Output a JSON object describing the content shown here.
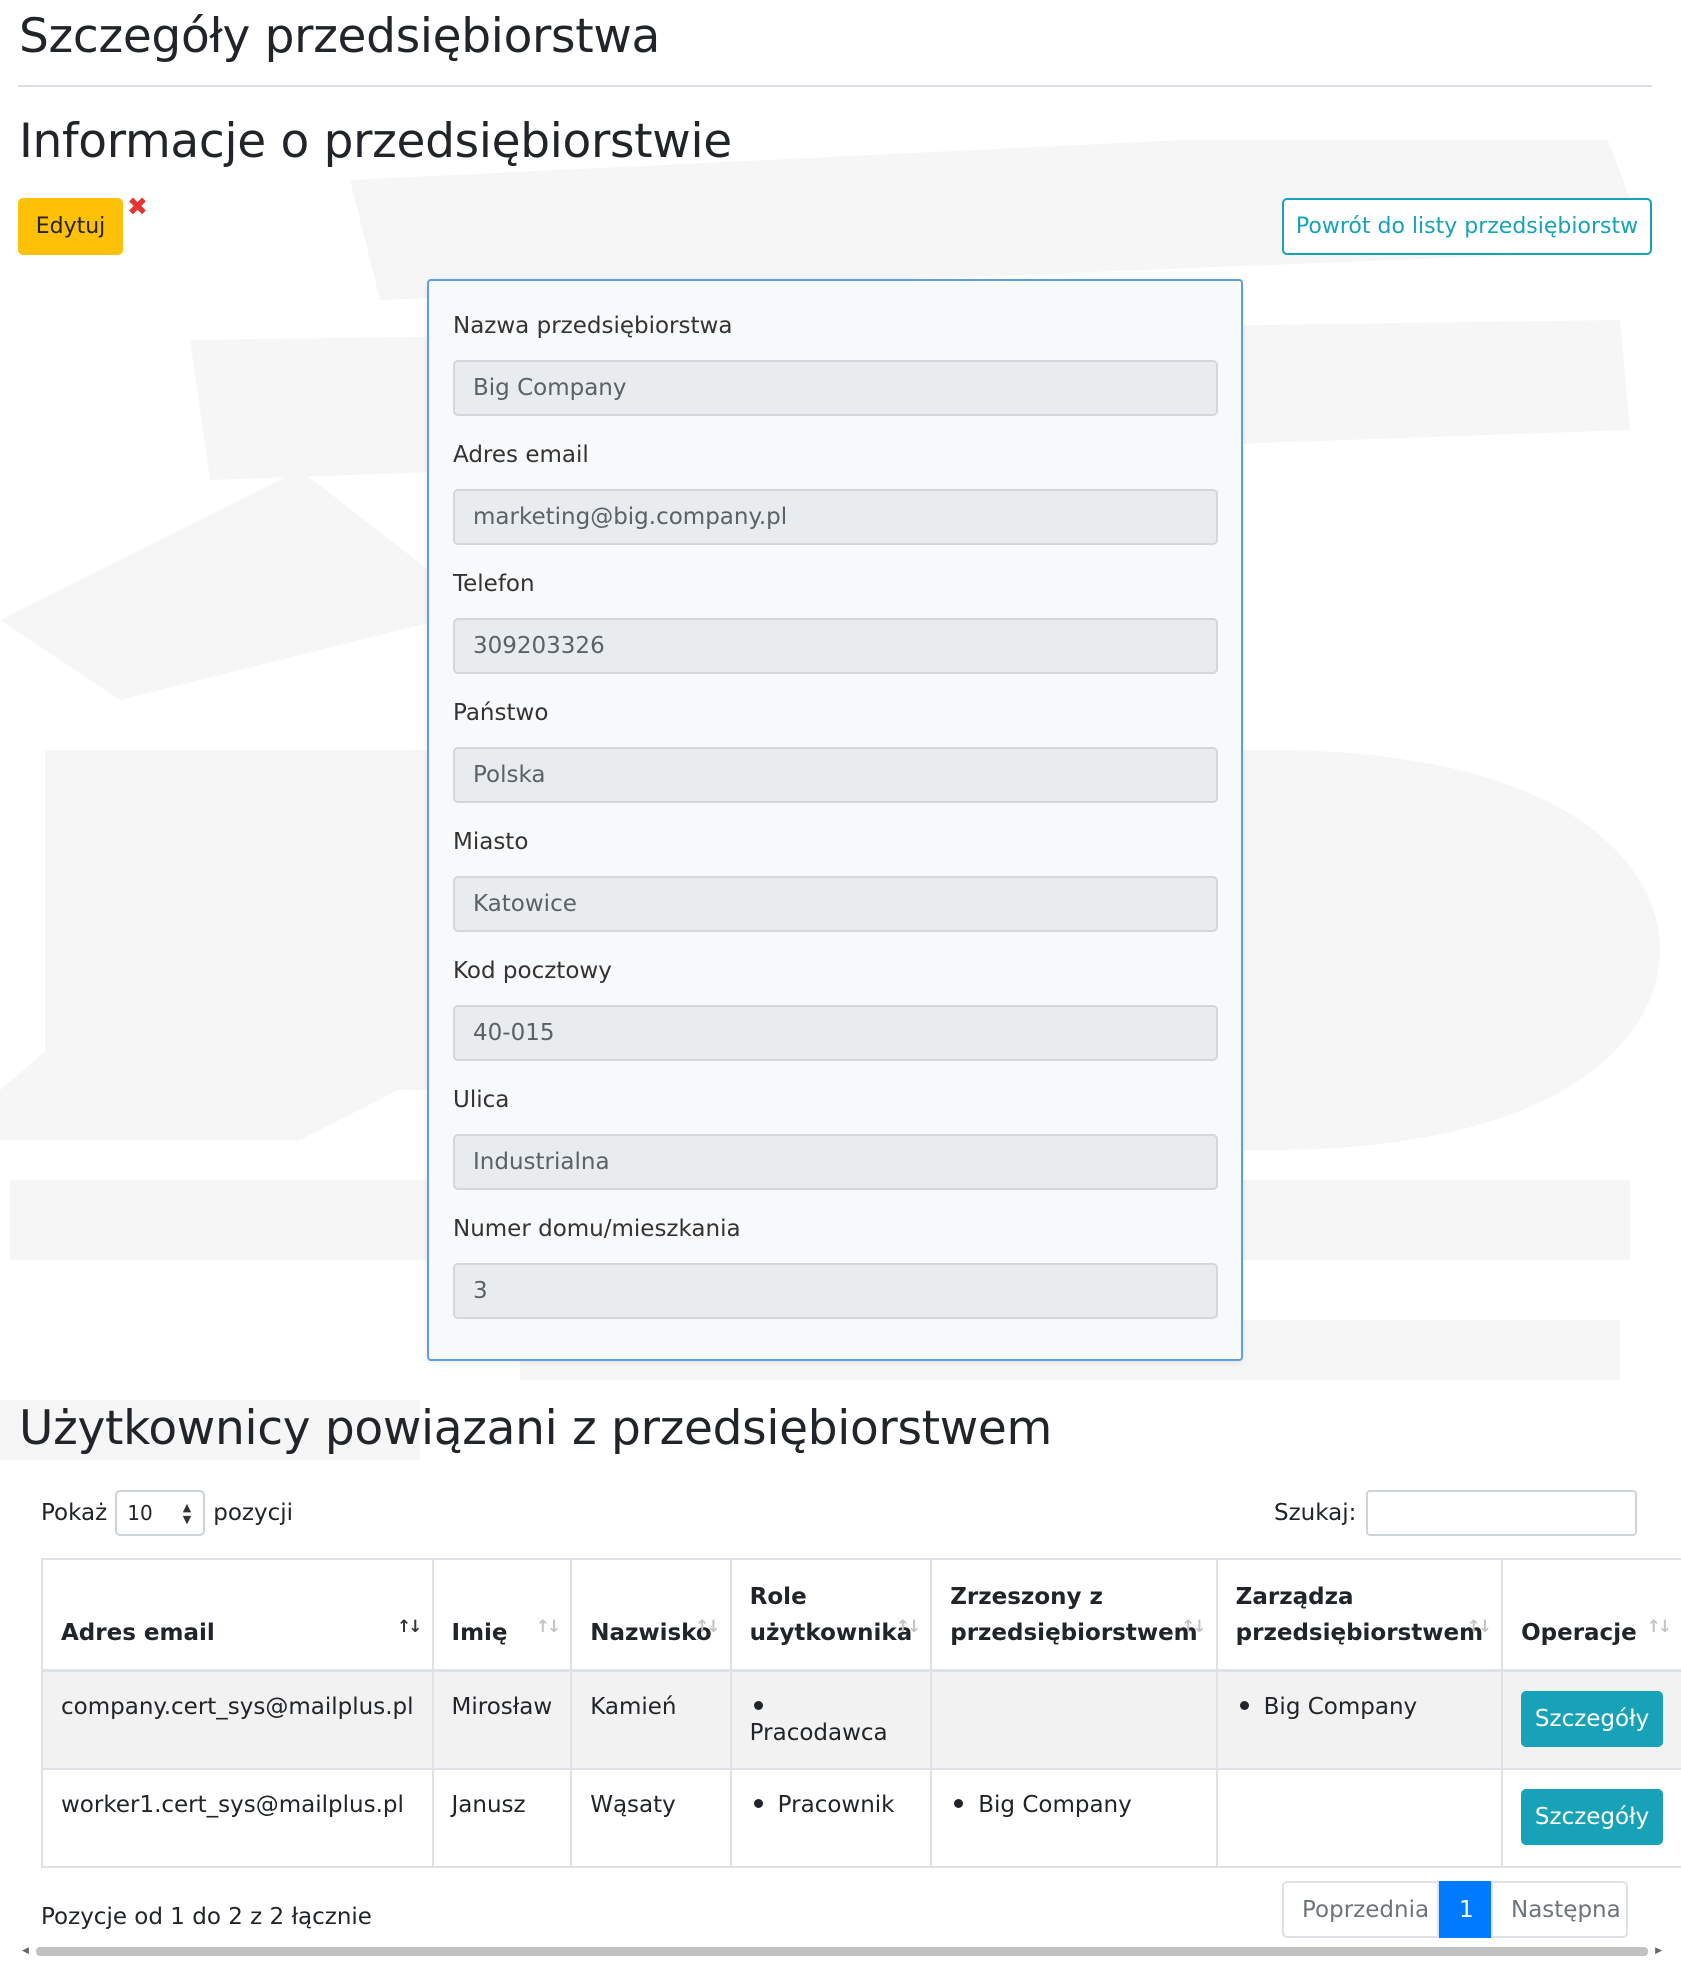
{
  "page_title": "Szczegóły przedsiębiorstwa",
  "section_title": "Informacje o przedsiębiorstwie",
  "actions": {
    "edit_label": "Edytuj",
    "delete_symbol": "✖",
    "back_label": "Powrót do listy przedsiębiorstw"
  },
  "company_form": {
    "fields": [
      {
        "label": "Nazwa przedsiębiorstwa",
        "value": "Big Company"
      },
      {
        "label": "Adres email",
        "value": "marketing@big.company.pl"
      },
      {
        "label": "Telefon",
        "value": "309203326"
      },
      {
        "label": "Państwo",
        "value": "Polska"
      },
      {
        "label": "Miasto",
        "value": "Katowice"
      },
      {
        "label": "Kod pocztowy",
        "value": "40-015"
      },
      {
        "label": "Ulica",
        "value": "Industrialna"
      },
      {
        "label": "Numer domu/mieszkania",
        "value": "3"
      }
    ]
  },
  "users_section": {
    "title": "Użytkownicy powiązani z przedsiębiorstwem",
    "length": {
      "prefix": "Pokaż",
      "value": "10",
      "suffix": "pozycji"
    },
    "search": {
      "label": "Szukaj:",
      "value": ""
    },
    "table": {
      "headers": {
        "email": "Adres email",
        "first_name": "Imię",
        "last_name": "Nazwisko",
        "roles_line1": "Role",
        "roles_line2": "użytkownika",
        "associated_line1": "Zrzeszony z",
        "associated_line2": "przedsiębiorstwem",
        "manages_line1": "Zarządza",
        "manages_line2": "przedsiębiorstwem",
        "operations": "Operacje"
      },
      "sort_active": "↑↓",
      "sort_inactive": "↑↓",
      "rows": [
        {
          "email": "company.cert_sys@mailplus.pl",
          "first_name": "Mirosław",
          "last_name": "Kamień",
          "role": "Pracodawca",
          "associated": "",
          "manages": "Big Company",
          "button": "Szczegóły"
        },
        {
          "email": "worker1.cert_sys@mailplus.pl",
          "first_name": "Janusz",
          "last_name": "Wąsaty",
          "role": "Pracownik",
          "associated": "Big Company",
          "manages": "",
          "button": "Szczegóły"
        }
      ]
    },
    "info": "Pozycje od 1 do 2 z 2 łącznie",
    "pagination": {
      "prev": "Poprzednia",
      "current": "1",
      "next": "Następna"
    }
  },
  "colors": {
    "edit_button": "#ffc107",
    "delete_icon": "#e3342f",
    "info_accent": "#17a2b8",
    "card_border": "#5d9fe0",
    "active_page": "#007bff"
  }
}
